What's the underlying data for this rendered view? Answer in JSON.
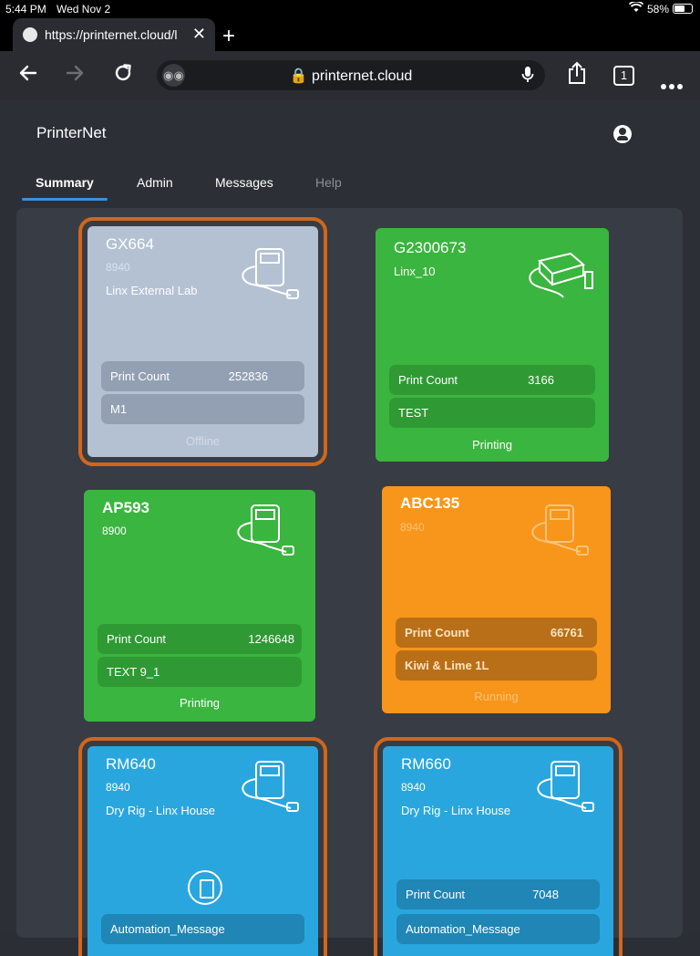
{
  "status_bar": {
    "time": "5:44 PM",
    "date": "Wed Nov 2",
    "battery": "58%"
  },
  "browser": {
    "tab_title": "https://printernet.cloud/l",
    "address": "printernet.cloud",
    "tab_count": "1"
  },
  "app": {
    "brand": "PrinterNet"
  },
  "nav": {
    "tabs": [
      {
        "label": "Summary"
      },
      {
        "label": "Admin"
      },
      {
        "label": "Messages"
      },
      {
        "label": "Help"
      }
    ]
  },
  "colors": {
    "offline": "#b3c0d2",
    "printing": "#3ab53f",
    "running": "#f7961b",
    "idle": "#2aa6de",
    "selection": "#d0671c"
  },
  "printers": [
    {
      "name": "GX664",
      "model": "8940",
      "location": "Linx External Lab",
      "count_label": "Print Count",
      "count": "252836",
      "message": "M1",
      "state": "Offline"
    },
    {
      "name": "G2300673",
      "model": "",
      "location": "Linx_10",
      "count_label": "Print Count",
      "count": "3166",
      "message": "TEST",
      "state": "Printing"
    },
    {
      "name": "AP593",
      "model": "8900",
      "location": "",
      "count_label": "Print Count",
      "count": "1246648",
      "message": "TEXT 9_1",
      "state": "Printing"
    },
    {
      "name": "ABC135",
      "model": "8940",
      "location": "",
      "count_label": "Print Count",
      "count": "66761",
      "message": "Kiwi & Lime 1L",
      "state": "Running"
    },
    {
      "name": "RM640",
      "model": "8940",
      "location": "Dry Rig - Linx House",
      "count_label": "",
      "count": "",
      "message": "Automation_Message",
      "state": ""
    },
    {
      "name": "RM660",
      "model": "8940",
      "location": "Dry Rig - Linx House",
      "count_label": "Print Count",
      "count": "7048",
      "message": "Automation_Message",
      "state": ""
    }
  ]
}
